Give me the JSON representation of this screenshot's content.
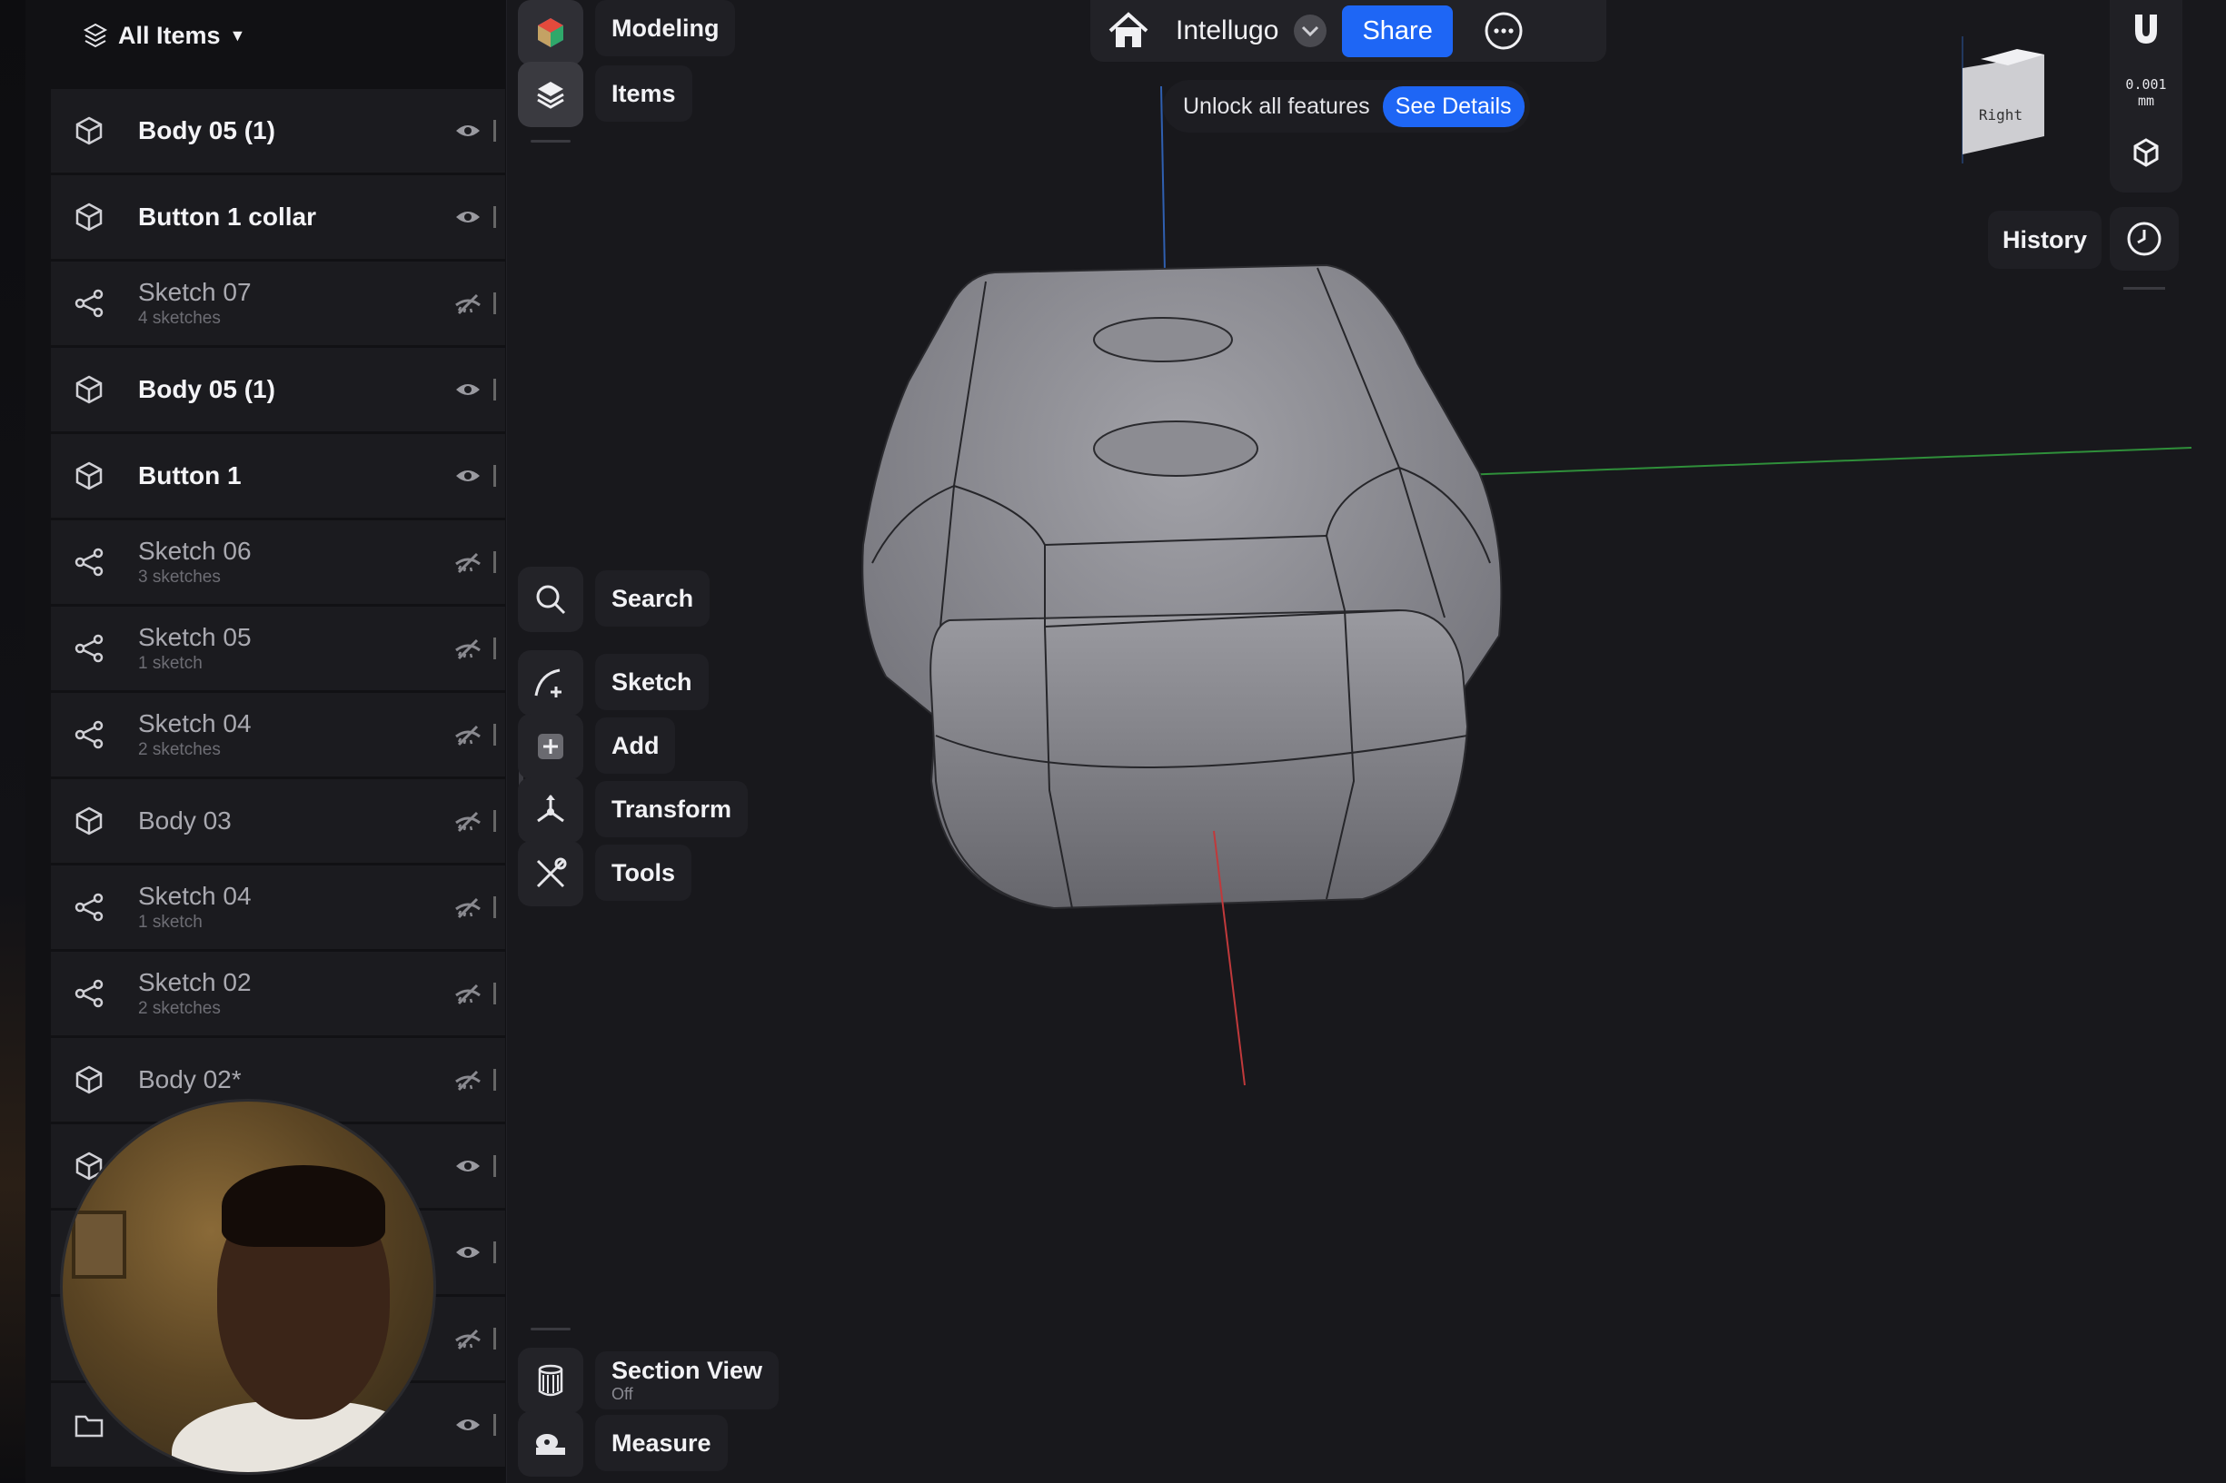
{
  "panel": {
    "header_label": "All Items",
    "items": [
      {
        "name": "Body 05 (1)",
        "sub": "",
        "type": "body",
        "visible": true
      },
      {
        "name": "Button 1 collar",
        "sub": "",
        "type": "body",
        "visible": true
      },
      {
        "name": "Sketch 07",
        "sub": "4 sketches",
        "type": "sketch",
        "visible": false
      },
      {
        "name": "Body 05 (1)",
        "sub": "",
        "type": "body",
        "visible": true
      },
      {
        "name": "Button 1",
        "sub": "",
        "type": "body",
        "visible": true
      },
      {
        "name": "Sketch 06",
        "sub": "3 sketches",
        "type": "sketch",
        "visible": false
      },
      {
        "name": "Sketch 05",
        "sub": "1 sketch",
        "type": "sketch",
        "visible": false
      },
      {
        "name": "Sketch 04",
        "sub": "2 sketches",
        "type": "sketch",
        "visible": false
      },
      {
        "name": "Body 03",
        "sub": "",
        "type": "body",
        "visible": false
      },
      {
        "name": "Sketch 04",
        "sub": "1 sketch",
        "type": "sketch",
        "visible": false
      },
      {
        "name": "Sketch 02",
        "sub": "2 sketches",
        "type": "sketch",
        "visible": false
      },
      {
        "name": "Body 02*",
        "sub": "",
        "type": "body",
        "visible": false
      },
      {
        "name": "",
        "sub": "",
        "type": "body",
        "visible": true
      },
      {
        "name": "",
        "sub": "",
        "type": "body",
        "visible": true
      },
      {
        "name": "",
        "sub": "",
        "type": "body",
        "visible": false
      },
      {
        "name": "",
        "sub": "",
        "type": "folder",
        "visible": true
      }
    ]
  },
  "toolbar": {
    "modeling": "Modeling",
    "items": "Items",
    "search": "Search",
    "sketch": "Sketch",
    "add": "Add",
    "transform": "Transform",
    "tools": "Tools",
    "section_view": "Section View",
    "section_view_state": "Off",
    "measure": "Measure"
  },
  "topbar": {
    "project_name": "Intellugo",
    "share_label": "Share",
    "promo_text": "Unlock all features",
    "details_label": "See Details"
  },
  "right": {
    "history_label": "History",
    "scale_value": "0.001",
    "scale_unit": "mm",
    "viewcube_face": "Right"
  },
  "colors": {
    "accent": "#1e66f5",
    "panel_bg": "#111114",
    "row_bg": "#1b1b1f",
    "viewport_bg": "#18181c",
    "model": "#8d8d93",
    "axis_x": "#c0393b",
    "axis_y": "#2f8f3a",
    "axis_z": "#2f5fb0"
  }
}
